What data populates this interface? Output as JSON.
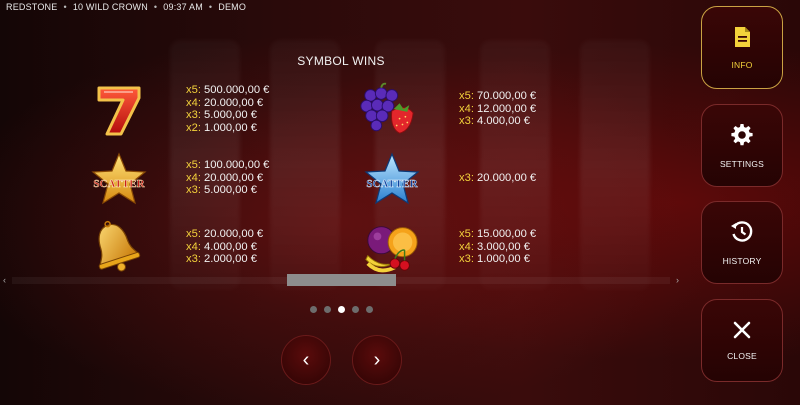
{
  "status_bar": {
    "provider": "REDSTONE",
    "game": "10 WILD CROWN",
    "time": "09:37 AM",
    "mode": "DEMO",
    "separator": "•"
  },
  "panel": {
    "title": "SYMBOL WINS",
    "symbols": [
      {
        "icon": "seven-icon",
        "pays": [
          {
            "m": "x5:",
            "v": "500.000,00 €"
          },
          {
            "m": "x4:",
            "v": "20.000,00 €"
          },
          {
            "m": "x3:",
            "v": "5.000,00 €"
          },
          {
            "m": "x2:",
            "v": "1.000,00 €"
          }
        ]
      },
      {
        "icon": "grapes-strawberry-icon",
        "pays": [
          {
            "m": "x5:",
            "v": "70.000,00 €"
          },
          {
            "m": "x4:",
            "v": "12.000,00 €"
          },
          {
            "m": "x3:",
            "v": "4.000,00 €"
          }
        ]
      },
      {
        "icon": "gold-scatter-star-icon",
        "text": "SCATTER",
        "pays": [
          {
            "m": "x5:",
            "v": "100.000,00 €"
          },
          {
            "m": "x4:",
            "v": "20.000,00 €"
          },
          {
            "m": "x3:",
            "v": "5.000,00 €"
          }
        ]
      },
      {
        "icon": "blue-scatter-star-icon",
        "text": "SCATTER",
        "pays": [
          {
            "m": "x3:",
            "v": "20.000,00 €"
          }
        ]
      },
      {
        "icon": "bell-icon",
        "pays": [
          {
            "m": "x5:",
            "v": "20.000,00 €"
          },
          {
            "m": "x4:",
            "v": "4.000,00 €"
          },
          {
            "m": "x3:",
            "v": "2.000,00 €"
          }
        ]
      },
      {
        "icon": "mixed-fruits-icon",
        "pays": [
          {
            "m": "x5:",
            "v": "15.000,00 €"
          },
          {
            "m": "x4:",
            "v": "3.000,00 €"
          },
          {
            "m": "x3:",
            "v": "1.000,00 €"
          }
        ]
      }
    ]
  },
  "scrollbar": {
    "left_arrow": "‹",
    "right_arrow": "›"
  },
  "pagination": {
    "total": 5,
    "current": 3
  },
  "nav": {
    "prev": "‹",
    "next": "›"
  },
  "side_menu": [
    {
      "label": "INFO",
      "icon": "document-icon",
      "active": true
    },
    {
      "label": "SETTINGS",
      "icon": "gear-icon",
      "active": false
    },
    {
      "label": "HISTORY",
      "icon": "history-icon",
      "active": false
    },
    {
      "label": "CLOSE",
      "icon": "close-icon",
      "active": false
    }
  ],
  "colors": {
    "multiplier": "#f3d23b",
    "active_border": "#caa243",
    "panel_bg": "#250303"
  }
}
